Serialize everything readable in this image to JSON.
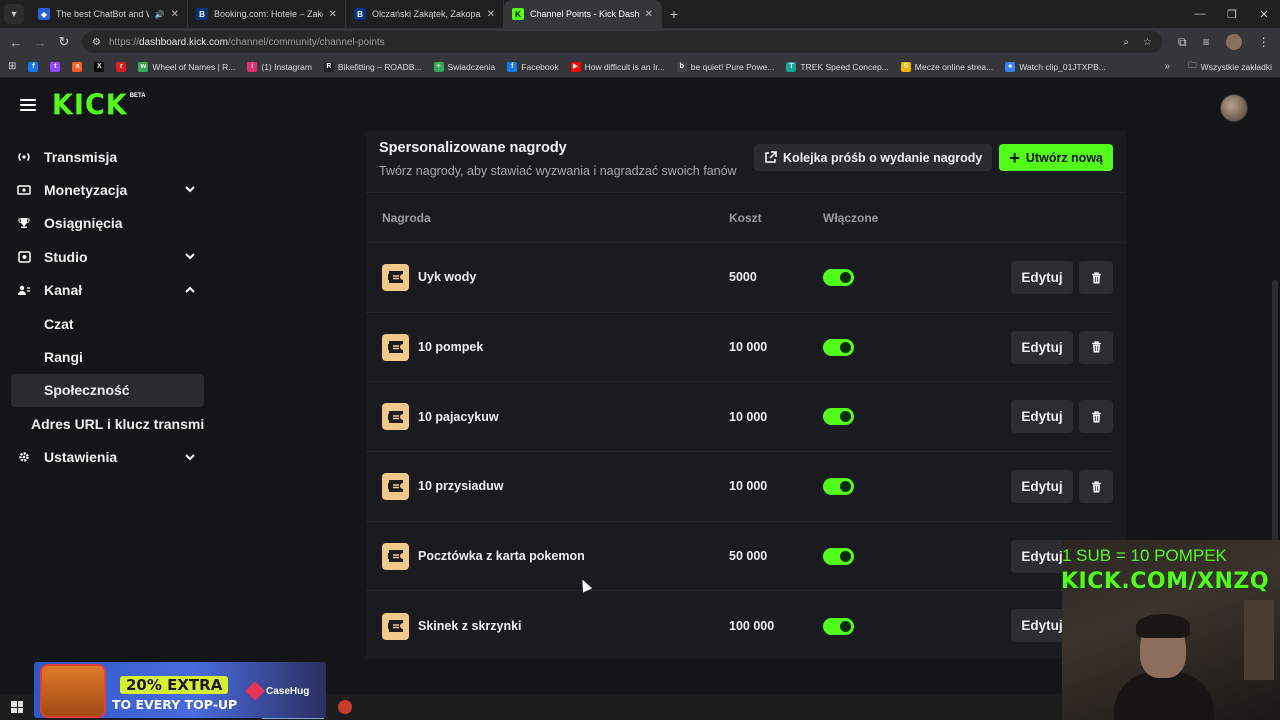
{
  "browser": {
    "tabs": [
      {
        "title": "The best ChatBot and Widg",
        "favicon": "shield",
        "active": false,
        "audio": true
      },
      {
        "title": "Booking.com: Hotele – Zakopan",
        "favicon": "B",
        "active": false,
        "audio": false
      },
      {
        "title": "Olczański Zakątek, Zakopane (a",
        "favicon": "B",
        "active": false,
        "audio": false
      },
      {
        "title": "Channel Points - Kick Dashboar",
        "favicon": "K",
        "active": true,
        "audio": false
      }
    ],
    "url_prefix": "https://",
    "url_domain": "dashboard.kick.com",
    "url_path": "/channel/community/channel-points",
    "bookmarks": [
      {
        "label": "",
        "icon": "f",
        "color": "#1877f2"
      },
      {
        "label": "",
        "icon": "t",
        "color": "#9146ff"
      },
      {
        "label": "",
        "icon": "a",
        "color": "#ff5a1f"
      },
      {
        "label": "",
        "icon": "X",
        "color": "#000000"
      },
      {
        "label": "",
        "icon": "r",
        "color": "#d91f26"
      },
      {
        "label": "Wheel of Names | R...",
        "icon": "w",
        "color": "#3aa757"
      },
      {
        "label": "(1) Instagram",
        "icon": "i",
        "color": "#e1306c"
      },
      {
        "label": "Bikefitting – ROADB...",
        "icon": "R",
        "color": "#222222"
      },
      {
        "label": "Swiadczenia",
        "icon": "+",
        "color": "#34a853"
      },
      {
        "label": "Facebook",
        "icon": "f",
        "color": "#1877f2"
      },
      {
        "label": "How difficult is an Ir...",
        "icon": "▶",
        "color": "#ff0000"
      },
      {
        "label": "be quiet! Pure Powe...",
        "icon": "b",
        "color": "#444444"
      },
      {
        "label": "TREK Speed Concep...",
        "icon": "T",
        "color": "#1aa39a"
      },
      {
        "label": "Mecze online strea...",
        "icon": "S",
        "color": "#f2b705"
      },
      {
        "label": "Watch clip_01JTXPB...",
        "icon": "●",
        "color": "#3b82f6"
      }
    ],
    "bookmarks_all": "Wszystkie zakładki"
  },
  "header": {
    "logo": "KICK",
    "logo_badge": "BETA"
  },
  "sidebar": {
    "items": [
      {
        "label": "Transmisja",
        "icon": "broadcast-icon",
        "chevron": ""
      },
      {
        "label": "Monetyzacja",
        "icon": "money-icon",
        "chevron": "down"
      },
      {
        "label": "Osiągnięcia",
        "icon": "trophy-icon",
        "chevron": ""
      },
      {
        "label": "Studio",
        "icon": "studio-icon",
        "chevron": "down"
      },
      {
        "label": "Kanał",
        "icon": "channel-icon",
        "chevron": "up"
      }
    ],
    "sub_items": [
      "Czat",
      "Rangi",
      "Społeczność"
    ],
    "active_sub": "Społeczność",
    "extra_item": "Adres URL i klucz transmisji",
    "settings": "Ustawienia"
  },
  "panel": {
    "title": "Spersonalizowane nagrody",
    "subtitle": "Twórz nagrody, aby stawiać wyzwania i nagradzać swoich fanów",
    "queue_button": "Kolejka próśb o wydanie nagrody",
    "new_button": "Utwórz nową",
    "columns": {
      "name": "Nagroda",
      "cost": "Koszt",
      "enabled": "Włączone"
    },
    "edit_label": "Edytuj",
    "rewards": [
      {
        "name": "Uyk wody",
        "cost": "5000",
        "enabled": true
      },
      {
        "name": "10 pompek",
        "cost": "10 000",
        "enabled": true
      },
      {
        "name": "10 pajacykuw",
        "cost": "10 000",
        "enabled": true
      },
      {
        "name": "10 przysiaduw",
        "cost": "10 000",
        "enabled": true
      },
      {
        "name": "Pocztówka z karta pokemon",
        "cost": "50 000",
        "enabled": true
      },
      {
        "name": "Skinek z skrzynki",
        "cost": "100 000",
        "enabled": true
      }
    ]
  },
  "overlay": {
    "line1": "1 SUB = 10 POMPEK",
    "line2": "KICK.COM/XNZQ"
  },
  "promo": {
    "headline": "20% EXTRA",
    "subline": "TO EVERY TOP-UP",
    "brand": "CaseHug"
  },
  "colors": {
    "accent": "#53fc18",
    "panel": "#191b1f",
    "background": "#141517"
  }
}
